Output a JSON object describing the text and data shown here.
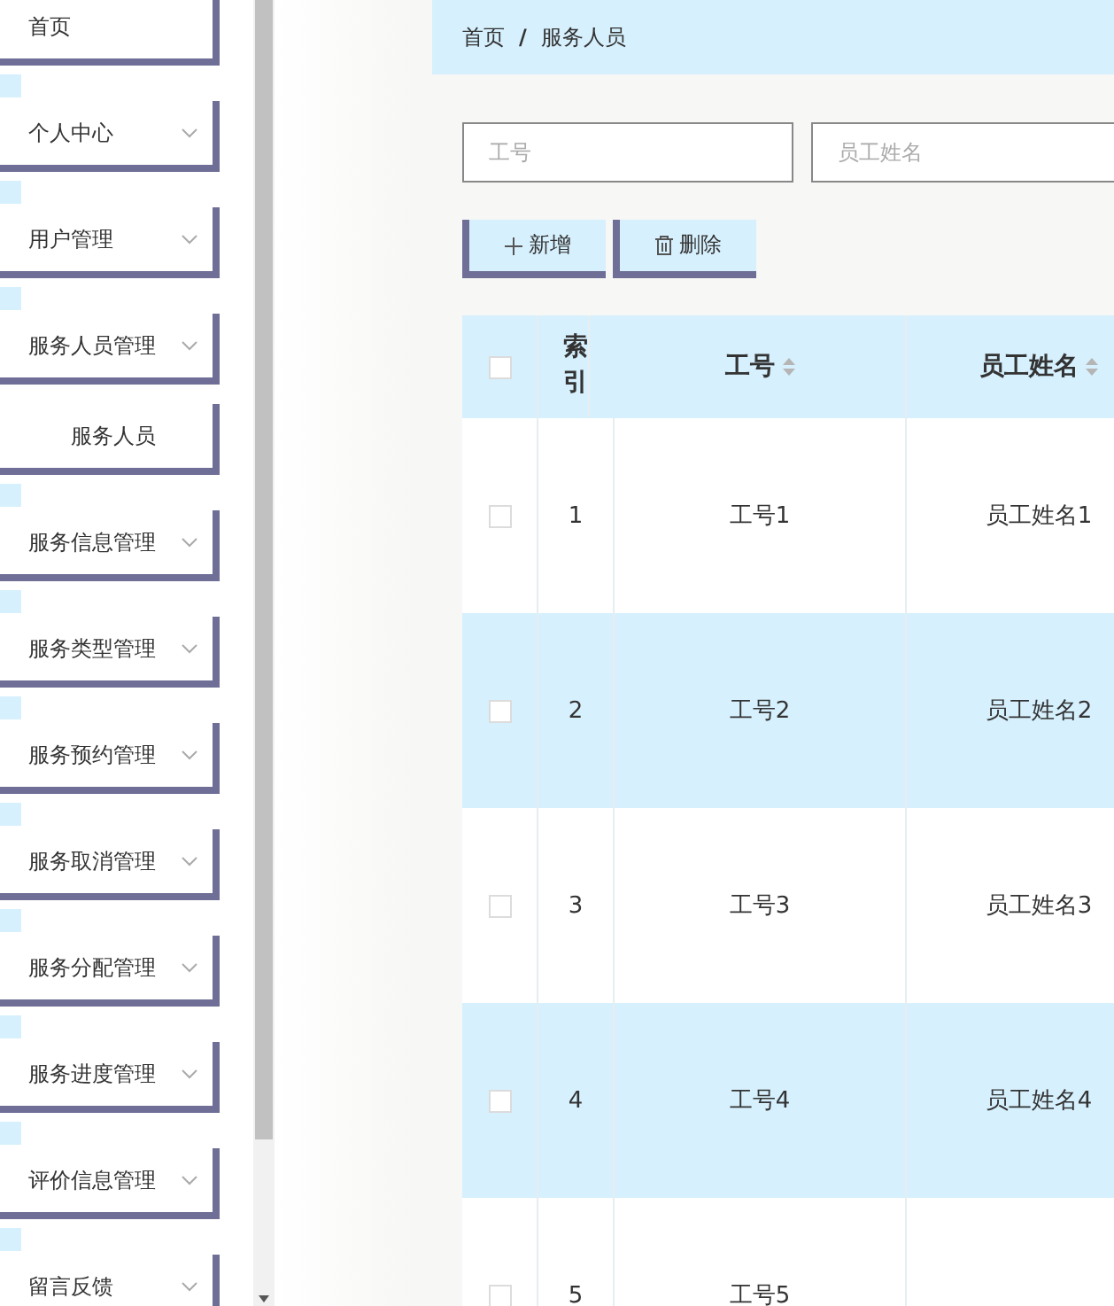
{
  "sidebar": {
    "items": [
      {
        "label": "首页",
        "expandable": false
      },
      {
        "label": "个人中心",
        "expandable": true
      },
      {
        "label": "用户管理",
        "expandable": true
      },
      {
        "label": "服务人员管理",
        "expandable": true,
        "children": [
          {
            "label": "服务人员"
          }
        ]
      },
      {
        "label": "服务信息管理",
        "expandable": true
      },
      {
        "label": "服务类型管理",
        "expandable": true
      },
      {
        "label": "服务预约管理",
        "expandable": true
      },
      {
        "label": "服务取消管理",
        "expandable": true
      },
      {
        "label": "服务分配管理",
        "expandable": true
      },
      {
        "label": "服务进度管理",
        "expandable": true
      },
      {
        "label": "评价信息管理",
        "expandable": true
      },
      {
        "label": "留言反馈",
        "expandable": true
      }
    ]
  },
  "breadcrumb": [
    "首页",
    "服务人员"
  ],
  "breadcrumb_separator": "/",
  "search": [
    {
      "placeholder": "工号"
    },
    {
      "placeholder": "员工姓名"
    }
  ],
  "buttons": [
    {
      "label": "新增",
      "kind": "add"
    },
    {
      "label": "删除",
      "kind": "delete"
    }
  ],
  "table": {
    "all_checked": false,
    "columns": [
      {
        "label": "索引",
        "sortable": false
      },
      {
        "label": "工号",
        "sortable": true
      },
      {
        "label": "员工姓名",
        "sortable": true
      }
    ],
    "rows": [
      {
        "cells": [
          "1",
          "工号1",
          "员工姓名1"
        ],
        "checked": false
      },
      {
        "cells": [
          "2",
          "工号2",
          "员工姓名2"
        ],
        "checked": false
      },
      {
        "cells": [
          "3",
          "工号3",
          "员工姓名3"
        ],
        "checked": false
      },
      {
        "cells": [
          "4",
          "工号4",
          "员工姓名4"
        ],
        "checked": false
      },
      {
        "cells": [
          "5",
          "工号5"
        ],
        "checked": false
      }
    ]
  }
}
